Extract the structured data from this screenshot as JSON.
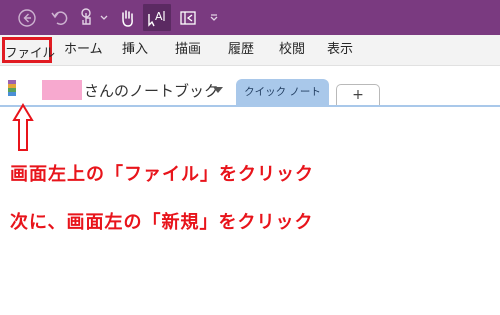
{
  "colors": {
    "titlebar": "#7a3a80",
    "accent_red": "#e8141b",
    "section_tab": "#a9c8ea",
    "redaction": "#f7a9cf"
  },
  "quick_access": {
    "icons": [
      "back-icon",
      "undo-icon",
      "touch-icon",
      "chevron-down-icon",
      "hand-icon",
      "text-select-icon",
      "dock-icon",
      "customize-icon"
    ]
  },
  "ribbon": {
    "tabs": [
      {
        "label": "ファイル"
      },
      {
        "label": "ホーム"
      },
      {
        "label": "挿入"
      },
      {
        "label": "描画"
      },
      {
        "label": "履歴"
      },
      {
        "label": "校閲"
      },
      {
        "label": "表示"
      }
    ]
  },
  "notebook": {
    "name_suffix": "さんのノートブック",
    "section_tab": "クイック ノート",
    "add_tab": "+"
  },
  "instructions": {
    "line1": "画面左上の「ファイル」をクリック",
    "line2": "次に、画面左の「新規」をクリック"
  }
}
